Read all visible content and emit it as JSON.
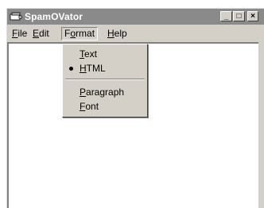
{
  "window": {
    "title": "SpamOVator",
    "icon": "app-icon",
    "controls": {
      "minimize": "_",
      "maximize": "□",
      "close": "×"
    }
  },
  "menubar": {
    "items": [
      {
        "label_pre": "",
        "label_u": "F",
        "label_post": "ile"
      },
      {
        "label_pre": "",
        "label_u": "E",
        "label_post": "dit"
      },
      {
        "label_pre": "F",
        "label_u": "o",
        "label_post": "rmat"
      },
      {
        "label_pre": "",
        "label_u": "H",
        "label_post": "elp"
      }
    ]
  },
  "format_menu": {
    "items": [
      {
        "label_pre": "",
        "label_u": "T",
        "label_post": "ext",
        "checked": false
      },
      {
        "label_pre": "",
        "label_u": "H",
        "label_post": "TML",
        "checked": true
      },
      {
        "label_pre": "",
        "label_u": "P",
        "label_post": "aragraph",
        "checked": false
      },
      {
        "label_pre": "",
        "label_u": "F",
        "label_post": "ont",
        "checked": false
      }
    ]
  },
  "colors": {
    "titlebar": "#8a8a8a",
    "face": "#d4d0c8",
    "client": "#ffffff"
  }
}
